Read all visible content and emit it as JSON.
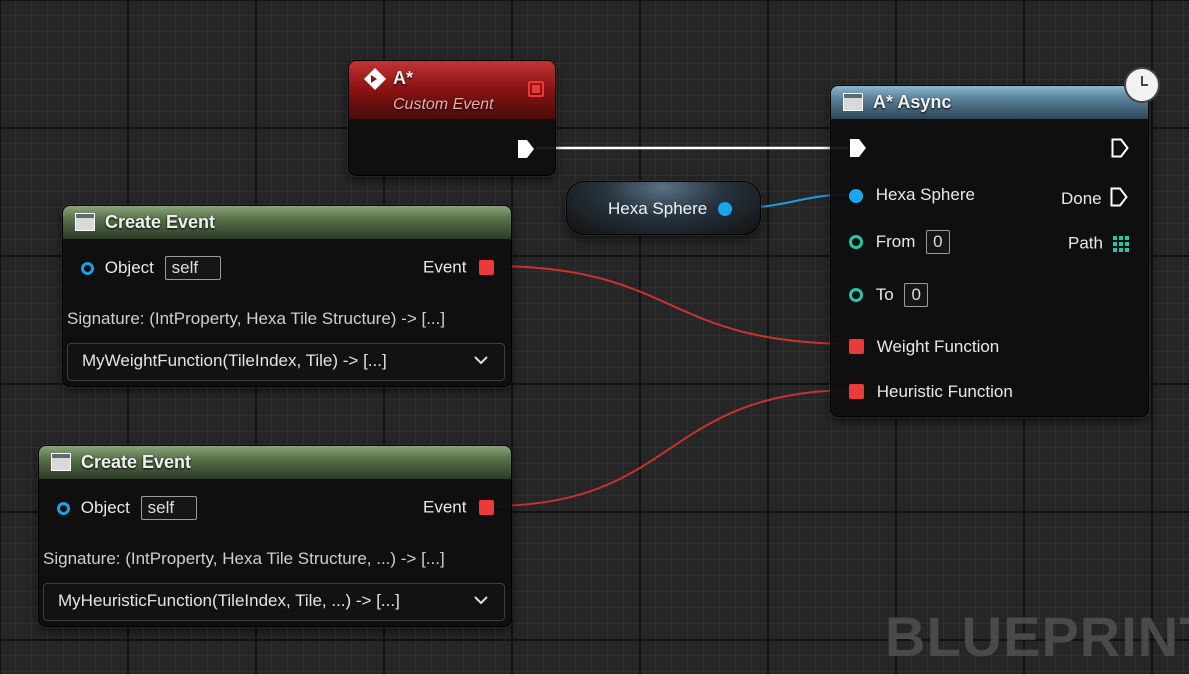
{
  "custom_event_node": {
    "title": "A*",
    "subtitle": "Custom Event"
  },
  "hexa_sphere_var": {
    "label": "Hexa Sphere"
  },
  "astar_async_node": {
    "title": "A* Async",
    "inputs": {
      "hexa_sphere": "Hexa Sphere",
      "from": "From",
      "from_value": "0",
      "to": "To",
      "to_value": "0",
      "weight_function": "Weight Function",
      "heuristic_function": "Heuristic Function"
    },
    "outputs": {
      "done": "Done",
      "path": "Path"
    }
  },
  "create_event_1": {
    "title": "Create Event",
    "object_label": "Object",
    "object_value": "self",
    "event_label": "Event",
    "signature": "Signature: (IntProperty, Hexa Tile Structure) -> [...]",
    "function": "MyWeightFunction(TileIndex, Tile) -> [...]"
  },
  "create_event_2": {
    "title": "Create Event",
    "object_label": "Object",
    "object_value": "self",
    "event_label": "Event",
    "signature": "Signature: (IntProperty, Hexa Tile Structure, ...) -> [...]",
    "function": "MyHeuristicFunction(TileIndex, Tile, ...) -> [...]"
  },
  "watermark": "BLUEPRINT",
  "colors": {
    "exec_wire": "#ffffff",
    "object_wire": "#1a9ee6",
    "delegate_wire": "#c83232",
    "delegate_pin": "#ea3a3a",
    "int_pin": "#1fc8a6"
  }
}
